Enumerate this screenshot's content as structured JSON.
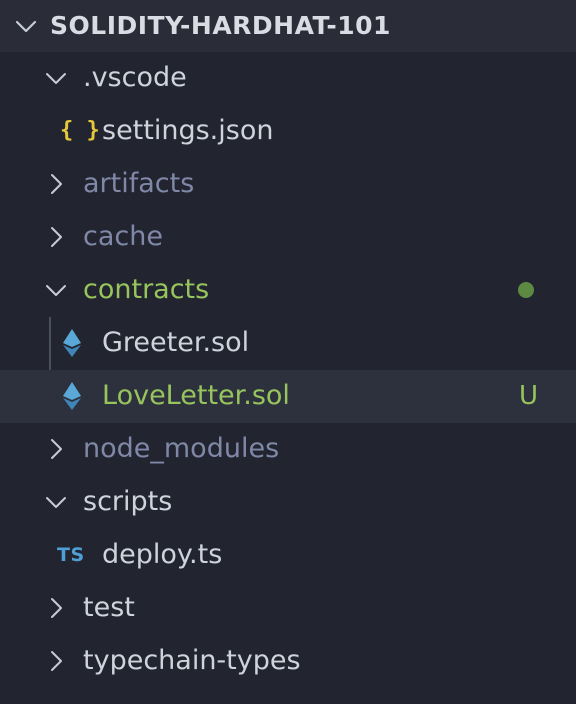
{
  "explorer": {
    "root_title": "SOLIDITY-HARDHAT-101",
    "items": [
      {
        "label": ".vscode",
        "kind": "folder",
        "expanded": true
      },
      {
        "label": "settings.json",
        "kind": "file",
        "icon": "json-icon",
        "icon_text": "{ }"
      },
      {
        "label": "artifacts",
        "kind": "folder",
        "expanded": false
      },
      {
        "label": "cache",
        "kind": "folder",
        "expanded": false
      },
      {
        "label": "contracts",
        "kind": "folder",
        "expanded": true
      },
      {
        "label": "Greeter.sol",
        "kind": "file",
        "icon": "ethereum-icon"
      },
      {
        "label": "LoveLetter.sol",
        "kind": "file",
        "icon": "ethereum-icon",
        "badge": "U",
        "selected": true
      },
      {
        "label": "node_modules",
        "kind": "folder",
        "expanded": false
      },
      {
        "label": "scripts",
        "kind": "folder",
        "expanded": true
      },
      {
        "label": "deploy.ts",
        "kind": "file",
        "icon": "typescript-icon",
        "icon_text": "TS"
      },
      {
        "label": "test",
        "kind": "folder",
        "expanded": false
      },
      {
        "label": "typechain-types",
        "kind": "folder",
        "expanded": false
      }
    ]
  },
  "colors": {
    "background": "#22252f",
    "header_bg": "#2a2d38",
    "selected_bg": "#2d313d",
    "untracked_green": "#97c45d",
    "ignored_gray": "#8088a8",
    "json_yellow": "#e5c83c",
    "ts_blue": "#4d9fd6",
    "eth_blue": "#5aa8d8",
    "modified_dot": "#5d8a42"
  }
}
